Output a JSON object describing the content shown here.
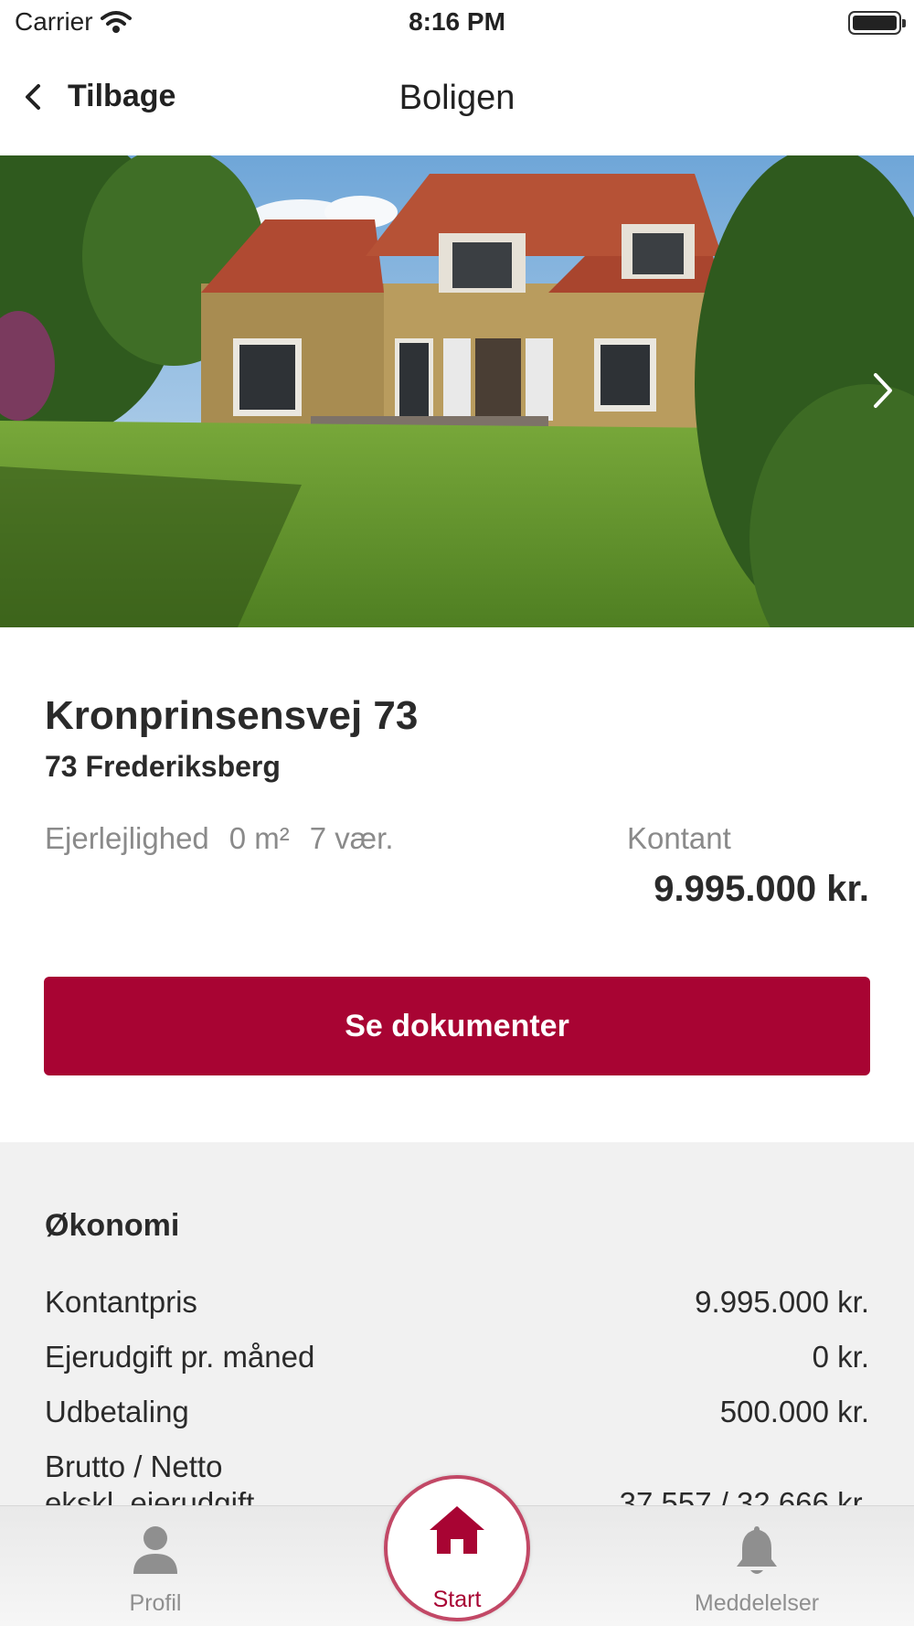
{
  "status_bar": {
    "carrier": "Carrier",
    "time": "8:16 PM"
  },
  "nav": {
    "back_label": "Tilbage",
    "title": "Boligen"
  },
  "property": {
    "address": "Kronprinsensvej 73",
    "area": "73 Frederiksberg",
    "type": "Ejerlejlighed",
    "size": "0 m²",
    "rooms": "7 vær.",
    "price_label": "Kontant",
    "price": "9.995.000 kr."
  },
  "cta": {
    "label": "Se dokumenter"
  },
  "economy": {
    "heading": "Økonomi",
    "rows": [
      {
        "label": "Kontantpris",
        "value": "9.995.000 kr."
      },
      {
        "label": "Ejerudgift pr. måned",
        "value": "0 kr."
      },
      {
        "label": "Udbetaling",
        "value": "500.000 kr."
      },
      {
        "label": "Brutto / Netto",
        "label2": "ekskl. ejerudgift",
        "value": "37.557 / 32.666 kr."
      }
    ]
  },
  "tabs": {
    "profile": {
      "label": "Profil",
      "icon": "person-icon"
    },
    "start": {
      "label": "Start",
      "icon": "home-icon"
    },
    "notifications": {
      "label": "Meddelelser",
      "icon": "bell-icon"
    }
  },
  "colors": {
    "accent": "#a80433",
    "tab_inactive": "#8f8f8f",
    "section_bg": "#f1f1f1"
  }
}
